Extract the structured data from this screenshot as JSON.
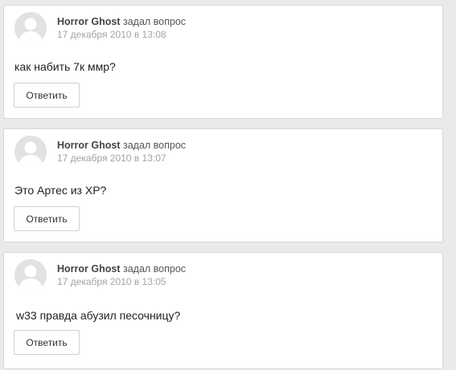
{
  "feed": {
    "items": [
      {
        "author": "Horror Ghost",
        "action": "задал вопрос",
        "timestamp": "17 декабря 2010 в 13:08",
        "question": "как набить 7к ммр?",
        "reply_label": "Ответить",
        "avatar_icon": "default-user-avatar-icon"
      },
      {
        "author": "Horror Ghost",
        "action": "задал вопрос",
        "timestamp": "17 декабря 2010 в 13:07",
        "question": "Это Артес из XP?",
        "reply_label": "Ответить",
        "avatar_icon": "default-user-avatar-icon"
      },
      {
        "author": "Horror Ghost",
        "action": "задал вопрос",
        "timestamp": "17 декабря 2010 в 13:05",
        "question": "w33 правда абузил песочницу?",
        "reply_label": "Ответить",
        "avatar_icon": "default-user-avatar-icon"
      }
    ]
  },
  "colors": {
    "page_background": "#eaeaea",
    "card_background": "#ffffff",
    "timestamp": "#a3a3a3"
  }
}
